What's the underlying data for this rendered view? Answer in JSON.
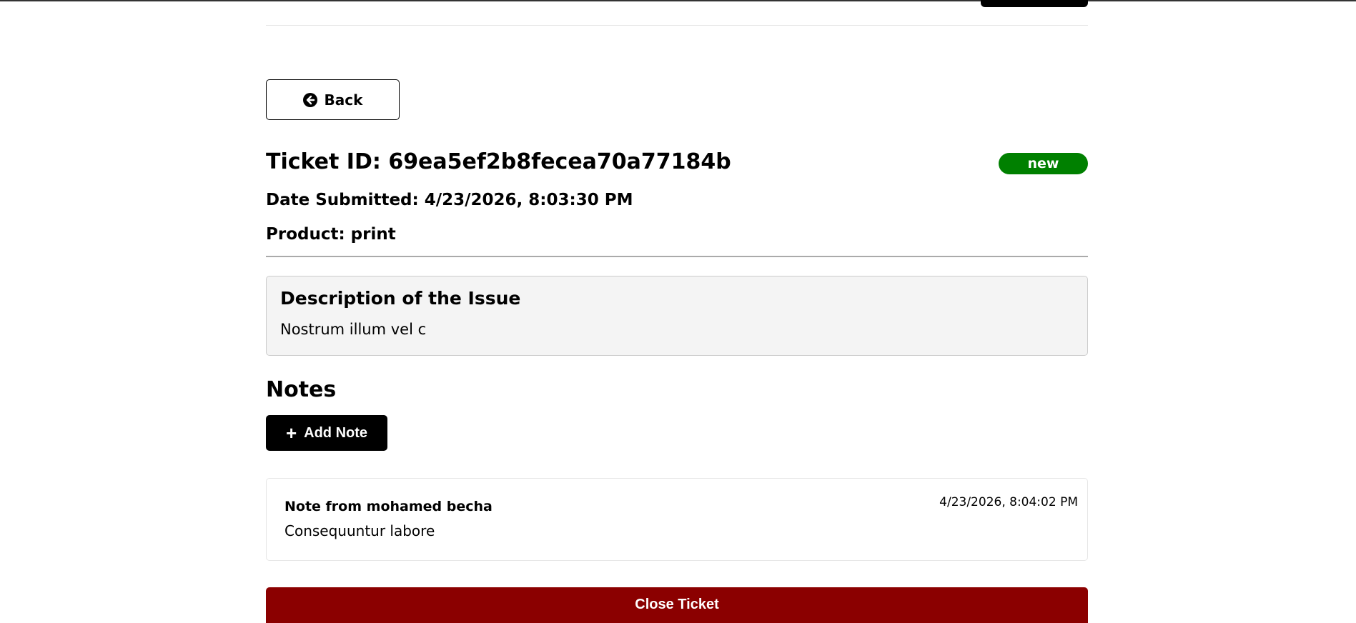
{
  "back_button": {
    "label": "Back",
    "icon": "arrow-circle-left-icon"
  },
  "ticket": {
    "title": "Ticket ID: 69ea5ef2b8fecea70a77184b",
    "status": "new",
    "status_color": "#008000",
    "date_submitted": "Date Submitted: 4/23/2026, 8:03:30 PM",
    "product": "Product: print"
  },
  "description": {
    "heading": "Description of the Issue",
    "text": "Nostrum illum vel c"
  },
  "notes": {
    "heading": "Notes",
    "add_button_label": "Add Note",
    "items": [
      {
        "author": "Note from mohamed becha",
        "date": "4/23/2026, 8:04:02 PM",
        "text": "Consequuntur labore"
      }
    ]
  },
  "close_button": {
    "label": "Close Ticket",
    "color": "#8b0000"
  }
}
